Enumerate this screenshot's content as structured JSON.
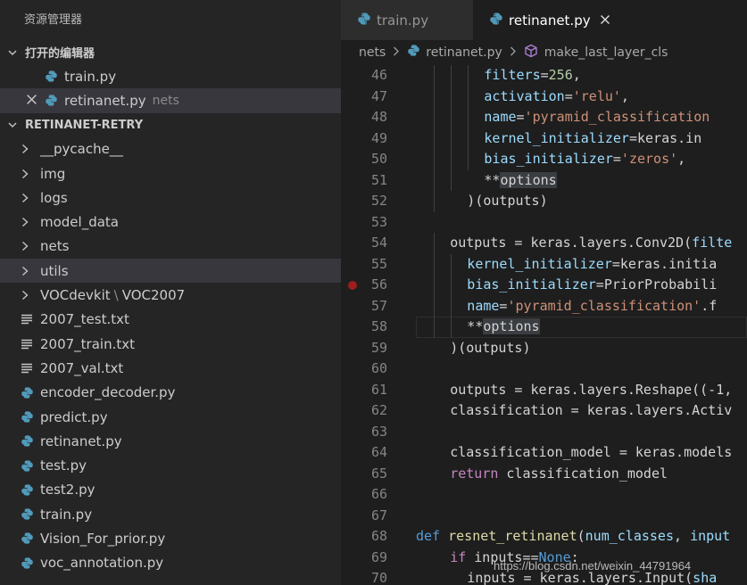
{
  "colors": {
    "python_icon": "#519aba",
    "text_file_icon": "#c5c5c5",
    "breakpoint": "#9c1e1e",
    "accent_kw": "#569cd6",
    "string": "#ce9178",
    "param": "#9cdcfe"
  },
  "explorer": {
    "title": "资源管理器",
    "open_editors": {
      "header": "打开的编辑器",
      "items": [
        {
          "label": "train.py",
          "icon": "python-icon"
        },
        {
          "label": "retinanet.py",
          "desc": "nets",
          "icon": "python-icon"
        }
      ]
    },
    "project": {
      "header": "RETINANET-RETRY",
      "items": [
        {
          "label": "__pycache__",
          "type": "folder"
        },
        {
          "label": "img",
          "type": "folder"
        },
        {
          "label": "logs",
          "type": "folder"
        },
        {
          "label": "model_data",
          "type": "folder"
        },
        {
          "label": "nets",
          "type": "folder"
        },
        {
          "label": "utils",
          "type": "folder"
        },
        {
          "label": "VOCdevkit",
          "label2": "VOC2007",
          "type": "folder"
        },
        {
          "label": "2007_test.txt",
          "type": "text"
        },
        {
          "label": "2007_train.txt",
          "type": "text"
        },
        {
          "label": "2007_val.txt",
          "type": "text"
        },
        {
          "label": "encoder_decoder.py",
          "type": "python"
        },
        {
          "label": "predict.py",
          "type": "python"
        },
        {
          "label": "retinanet.py",
          "type": "python"
        },
        {
          "label": "test.py",
          "type": "python"
        },
        {
          "label": "test2.py",
          "type": "python"
        },
        {
          "label": "train.py",
          "type": "python"
        },
        {
          "label": "Vision_For_prior.py",
          "type": "python"
        },
        {
          "label": "voc_annotation.py",
          "type": "python"
        }
      ]
    }
  },
  "tabs": [
    {
      "label": "train.py",
      "active": false
    },
    {
      "label": "retinanet.py",
      "active": true
    }
  ],
  "breadcrumb": {
    "folder": "nets",
    "file": "retinanet.py",
    "symbol": "make_last_layer_cls"
  },
  "editor": {
    "breakpoint_line": 56,
    "current_line": 58,
    "lines": [
      {
        "n": 46,
        "indent": 4,
        "tokens": [
          [
            "filters",
            "id"
          ],
          [
            "=",
            "op"
          ],
          [
            "256",
            "num"
          ],
          [
            ",",
            "op"
          ]
        ]
      },
      {
        "n": 47,
        "indent": 4,
        "tokens": [
          [
            "activation",
            "id"
          ],
          [
            "=",
            "op"
          ],
          [
            "'relu'",
            "str"
          ],
          [
            ",",
            "op"
          ]
        ]
      },
      {
        "n": 48,
        "indent": 4,
        "tokens": [
          [
            "name",
            "id"
          ],
          [
            "=",
            "op"
          ],
          [
            "'pyramid_classification",
            "str"
          ]
        ]
      },
      {
        "n": 49,
        "indent": 4,
        "tokens": [
          [
            "kernel_initializer",
            "id"
          ],
          [
            "=keras.in",
            "op"
          ]
        ]
      },
      {
        "n": 50,
        "indent": 4,
        "tokens": [
          [
            "bias_initializer",
            "id"
          ],
          [
            "=",
            "op"
          ],
          [
            "'zeros'",
            "str"
          ],
          [
            ",",
            "op"
          ]
        ]
      },
      {
        "n": 51,
        "indent": 4,
        "tokens": [
          [
            "**",
            "op"
          ],
          [
            "options",
            "hl"
          ]
        ]
      },
      {
        "n": 52,
        "indent": 3,
        "tokens": [
          [
            ")(outputs)",
            "op"
          ]
        ]
      },
      {
        "n": 53,
        "indent": 0,
        "tokens": []
      },
      {
        "n": 54,
        "indent": 2,
        "tokens": [
          [
            "outputs = keras.layers.Conv2D(",
            "op"
          ],
          [
            "filte",
            "id"
          ]
        ]
      },
      {
        "n": 55,
        "indent": 3,
        "tokens": [
          [
            "kernel_initializer",
            "id"
          ],
          [
            "=keras.initia",
            "op"
          ]
        ]
      },
      {
        "n": 56,
        "indent": 3,
        "tokens": [
          [
            "bias_initializer",
            "id"
          ],
          [
            "=PriorProbabili",
            "op"
          ]
        ]
      },
      {
        "n": 57,
        "indent": 3,
        "tokens": [
          [
            "name",
            "id"
          ],
          [
            "=",
            "op"
          ],
          [
            "'pyramid_classification'",
            "str"
          ],
          [
            ".f",
            "op"
          ]
        ]
      },
      {
        "n": 58,
        "indent": 3,
        "tokens": [
          [
            "**",
            "op"
          ],
          [
            "options",
            "hl"
          ]
        ]
      },
      {
        "n": 59,
        "indent": 2,
        "tokens": [
          [
            ")(outputs)",
            "op"
          ]
        ]
      },
      {
        "n": 60,
        "indent": 0,
        "tokens": []
      },
      {
        "n": 61,
        "indent": 2,
        "tokens": [
          [
            "outputs = keras.layers.Reshape((-1,",
            "op"
          ]
        ]
      },
      {
        "n": 62,
        "indent": 2,
        "tokens": [
          [
            "classification = keras.layers.Activ",
            "op"
          ]
        ]
      },
      {
        "n": 63,
        "indent": 0,
        "tokens": []
      },
      {
        "n": 64,
        "indent": 2,
        "tokens": [
          [
            "classification_model = keras.models",
            "op"
          ]
        ]
      },
      {
        "n": 65,
        "indent": 2,
        "tokens": [
          [
            "return",
            "kw2"
          ],
          [
            " classification_model",
            "op"
          ]
        ]
      },
      {
        "n": 66,
        "indent": 0,
        "tokens": []
      },
      {
        "n": 67,
        "indent": 0,
        "tokens": []
      },
      {
        "n": 68,
        "indent": 0,
        "tokens": [
          [
            "def",
            "kw"
          ],
          [
            " ",
            "op"
          ],
          [
            "resnet_retinanet",
            "fn"
          ],
          [
            "(",
            "op"
          ],
          [
            "num_classes",
            "id"
          ],
          [
            ", ",
            "op"
          ],
          [
            "input",
            "id"
          ]
        ]
      },
      {
        "n": 69,
        "indent": 2,
        "tokens": [
          [
            "if",
            "kw2"
          ],
          [
            " inputs==",
            "op"
          ],
          [
            "None",
            "kw"
          ],
          [
            ":",
            "op"
          ]
        ]
      },
      {
        "n": 70,
        "indent": 3,
        "tokens": [
          [
            "inputs = keras.layers.Input(",
            "op"
          ],
          [
            "sha",
            "id"
          ]
        ]
      }
    ]
  },
  "watermark": "https://blog.csdn.net/weixin_44791964"
}
